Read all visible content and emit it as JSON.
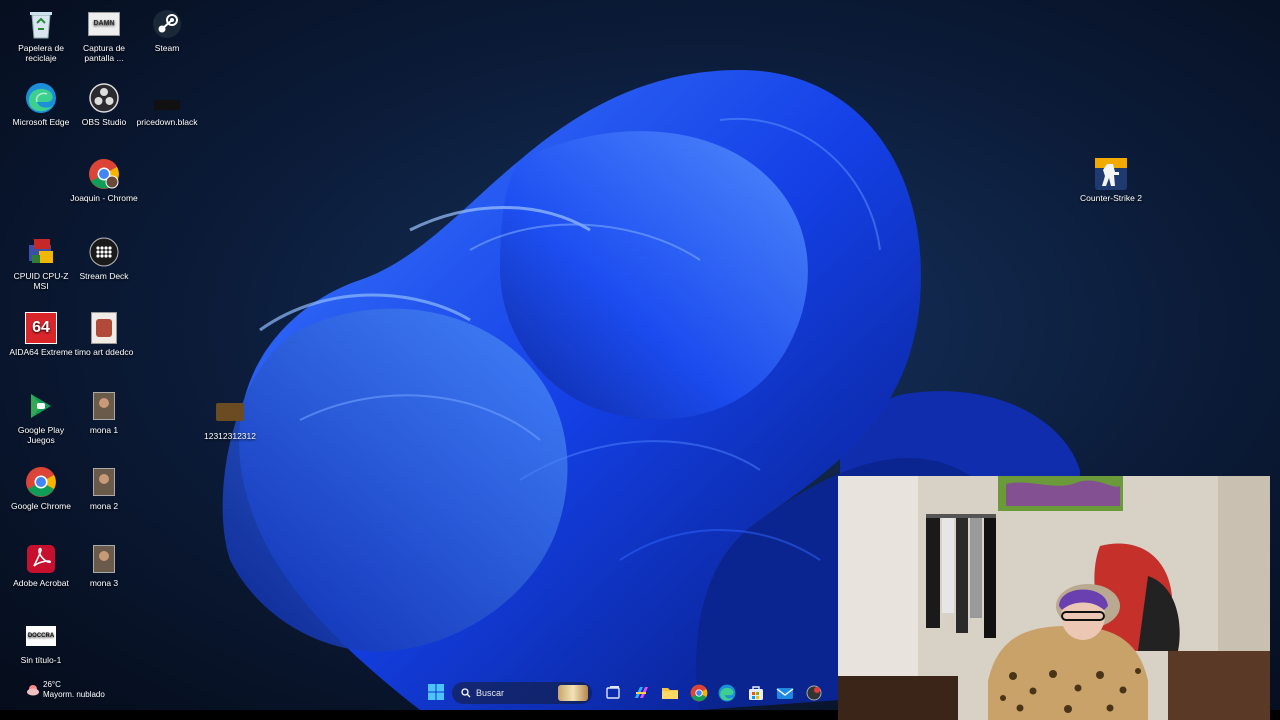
{
  "desktop": {
    "icons": [
      {
        "id": "recycle-bin",
        "label": "Papelera de reciclaje",
        "icon": "recycle-bin-icon"
      },
      {
        "id": "screenshot",
        "label": "Captura de pantalla ...",
        "icon": "screenshot-file-icon",
        "badge_text": "DAMN"
      },
      {
        "id": "steam",
        "label": "Steam",
        "icon": "steam-icon"
      },
      {
        "id": "edge",
        "label": "Microsoft Edge",
        "icon": "edge-icon"
      },
      {
        "id": "obs",
        "label": "OBS Studio",
        "icon": "obs-icon"
      },
      {
        "id": "pricedown",
        "label": "pricedown.black",
        "icon": "font-file-icon"
      },
      {
        "id": "joaquin-chrome",
        "label": "Joaquin - Chrome",
        "icon": "chrome-profile-icon"
      },
      {
        "id": "cpuz",
        "label": "CPUID CPU-Z MSI",
        "icon": "cpuz-icon"
      },
      {
        "id": "streamdeck",
        "label": "Stream Deck",
        "icon": "stream-deck-icon"
      },
      {
        "id": "aida64",
        "label": "AIDA64 Extreme",
        "icon": "aida64-icon",
        "badge_text": "64"
      },
      {
        "id": "timo-art",
        "label": "timo art ddedco",
        "icon": "image-file-icon"
      },
      {
        "id": "12312312312",
        "label": "12312312312",
        "icon": "image-file-icon"
      },
      {
        "id": "google-play",
        "label": "Google Play Juegos",
        "icon": "google-play-games-icon"
      },
      {
        "id": "mona1",
        "label": "mona 1",
        "icon": "image-file-icon"
      },
      {
        "id": "chrome",
        "label": "Google Chrome",
        "icon": "chrome-icon"
      },
      {
        "id": "mona2",
        "label": "mona 2",
        "icon": "image-file-icon"
      },
      {
        "id": "acrobat",
        "label": "Adobe Acrobat",
        "icon": "acrobat-icon"
      },
      {
        "id": "mona3",
        "label": "mona 3",
        "icon": "image-file-icon"
      },
      {
        "id": "sin-titulo",
        "label": "Sin título-1",
        "icon": "document-file-icon",
        "badge_text": "DOCCRA"
      },
      {
        "id": "cs2",
        "label": "Counter-Strike 2",
        "icon": "counter-strike-icon"
      }
    ]
  },
  "taskbar": {
    "search_placeholder": "Buscar",
    "weather": {
      "temperature": "26°C",
      "condition": "Mayorm. nublado"
    },
    "pinned": [
      "windows-start-icon",
      "search-icon",
      "widgets-icon",
      "task-view-icon",
      "copilot-icon",
      "file-explorer-icon",
      "chrome-icon",
      "edge-icon",
      "store-icon",
      "mail-icon",
      "red-app-icon"
    ]
  },
  "colors": {
    "background": "#0a1428",
    "accent_blue": "#1f56ff",
    "chrome_red": "#db4437",
    "chrome_yellow": "#f4b400",
    "chrome_green": "#0f9d58",
    "chrome_blue": "#4285f4",
    "acrobat_red": "#c8102e",
    "aida_red": "#d9262b",
    "steam_blue": "#1b2838"
  },
  "webcam_overlay": {
    "description_icon": "webcam-feed"
  }
}
